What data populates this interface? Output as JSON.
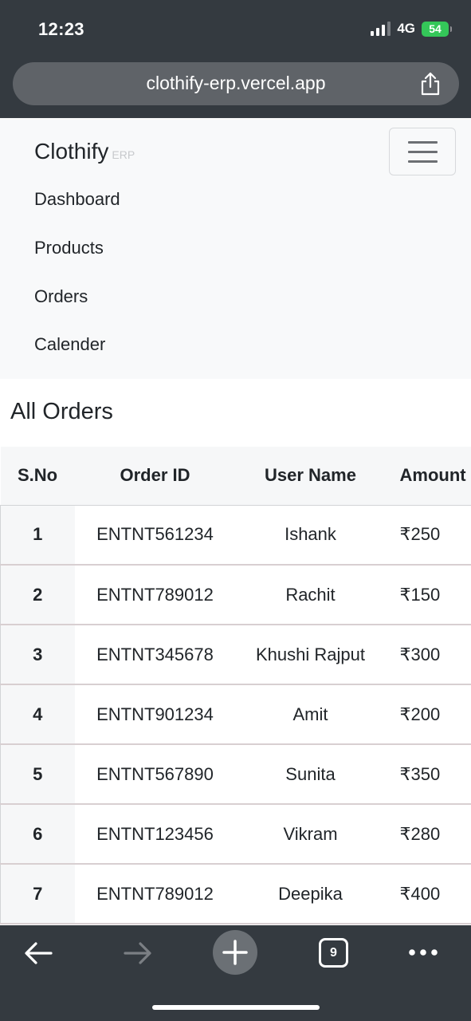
{
  "status": {
    "time": "12:23",
    "network": "4G",
    "battery": "54"
  },
  "browser": {
    "url": "clothify-erp.vercel.app"
  },
  "navbar": {
    "brand": "Clothify",
    "brand_sub": "ERP",
    "links": [
      "Dashboard",
      "Products",
      "Orders",
      "Calender"
    ]
  },
  "page": {
    "title": "All Orders"
  },
  "table": {
    "headers": [
      "S.No",
      "Order ID",
      "User Name",
      "Amount"
    ],
    "rows": [
      {
        "sno": "1",
        "order_id": "ENTNT561234",
        "user": "Ishank",
        "amount": "₹250"
      },
      {
        "sno": "2",
        "order_id": "ENTNT789012",
        "user": "Rachit",
        "amount": "₹150"
      },
      {
        "sno": "3",
        "order_id": "ENTNT345678",
        "user": "Khushi Rajput",
        "amount": "₹300"
      },
      {
        "sno": "4",
        "order_id": "ENTNT901234",
        "user": "Amit",
        "amount": "₹200"
      },
      {
        "sno": "5",
        "order_id": "ENTNT567890",
        "user": "Sunita",
        "amount": "₹350"
      },
      {
        "sno": "6",
        "order_id": "ENTNT123456",
        "user": "Vikram",
        "amount": "₹280"
      },
      {
        "sno": "7",
        "order_id": "ENTNT789012",
        "user": "Deepika",
        "amount": "₹400"
      }
    ]
  },
  "toolbar": {
    "tab_count": "9"
  },
  "colors": {
    "chrome": "#343a40",
    "battery": "#34c759",
    "navbar_bg": "#f8f9fa"
  }
}
